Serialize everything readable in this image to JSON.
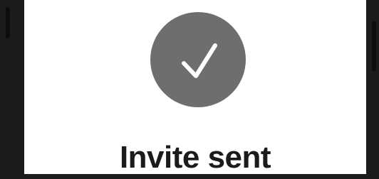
{
  "confirmation": {
    "title": "Invite sent",
    "icon": "checkmark-icon"
  },
  "colors": {
    "badge": "#6e6e6e",
    "checkmark": "#ffffff",
    "title": "#1b1b1b",
    "screen": "#ffffff",
    "frame": "#1b1b1b"
  }
}
